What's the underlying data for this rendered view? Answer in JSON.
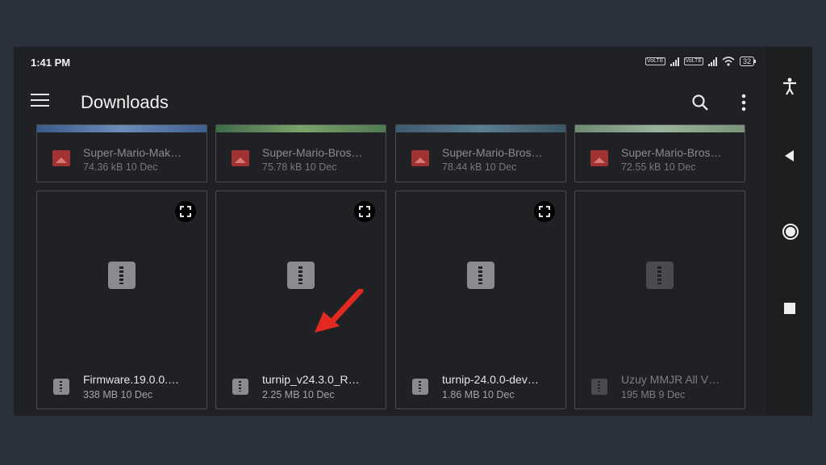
{
  "status": {
    "time": "1:41 PM",
    "volte": "Vo LTE",
    "battery": "32"
  },
  "header": {
    "title": "Downloads",
    "menu_icon": "hamburger-menu-icon",
    "search_icon": "search-icon",
    "more_icon": "more-vert-icon"
  },
  "colors": {
    "accent_arrow": "#e32a22",
    "image_icon": "#a03232"
  },
  "top_row": [
    {
      "name": "Super-Mario-Mak…",
      "meta": "74.36 kB 10 Dec"
    },
    {
      "name": "Super-Mario-Bros…",
      "meta": "75.78 kB 10 Dec"
    },
    {
      "name": "Super-Mario-Bros…",
      "meta": "78.44 kB 10 Dec"
    },
    {
      "name": "Super-Mario-Bros…",
      "meta": "72.55 kB 10 Dec"
    }
  ],
  "bottom_row": [
    {
      "name": "Firmware.19.0.0.…",
      "meta": "338 MB 10 Dec"
    },
    {
      "name": "turnip_v24.3.0_R…",
      "meta": "2.25 MB 10 Dec"
    },
    {
      "name": "turnip-24.0.0-dev…",
      "meta": "1.86 MB 10 Dec"
    },
    {
      "name": "Uzuy MMJR All V…",
      "meta": "195 MB 9 Dec"
    }
  ],
  "nav": [
    "accessibility-icon",
    "back-icon",
    "home-icon",
    "recents-icon"
  ]
}
